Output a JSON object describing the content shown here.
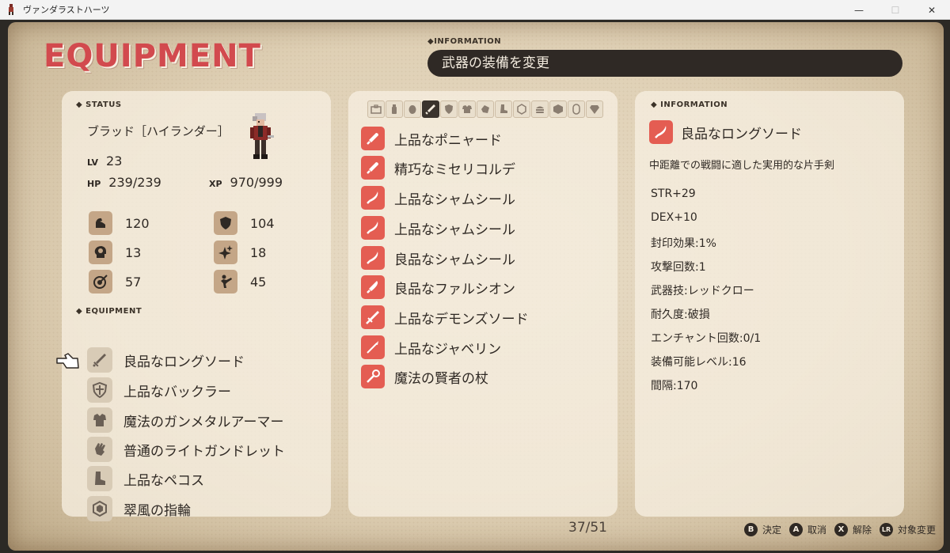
{
  "window": {
    "title": "ヴァンダラストハーツ",
    "controls": {
      "minimize": "—",
      "maximize": "☐",
      "close": "✕"
    }
  },
  "header": {
    "title": "EQUIPMENT",
    "info_label": "◆INFORMATION",
    "info_text": "武器の装備を変更"
  },
  "status": {
    "section_label": "◆ STATUS",
    "name": "ブラッド［ハイランダー］",
    "lv_label": "LV",
    "lv": "23",
    "hp_label": "HP",
    "hp": "239/239",
    "xp_label": "XP",
    "xp": "970/999",
    "attributes": [
      {
        "icon": "strength-arm-icon",
        "value": "120"
      },
      {
        "icon": "shield-defense-icon",
        "value": "104"
      },
      {
        "icon": "brain-intelligence-icon",
        "value": "13"
      },
      {
        "icon": "sparkle-magic-icon",
        "value": "18"
      },
      {
        "icon": "target-accuracy-icon",
        "value": "57"
      },
      {
        "icon": "kick-agility-icon",
        "value": "45"
      }
    ]
  },
  "equipment": {
    "section_label": "◆ EQUIPMENT",
    "items": [
      {
        "icon": "sword-icon",
        "name": "良品なロングソード"
      },
      {
        "icon": "shield-icon",
        "name": "上品なバックラー"
      },
      {
        "icon": "armor-icon",
        "name": "魔法のガンメタルアーマー"
      },
      {
        "icon": "gauntlet-icon",
        "name": "普通のライトガンドレット"
      },
      {
        "icon": "boots-icon",
        "name": "上品なペコス"
      },
      {
        "icon": "ring-icon",
        "name": "翠風の指輪"
      }
    ]
  },
  "categories": [
    "all-items-icon",
    "potion-icon",
    "egg-icon",
    "weapon-sword-icon",
    "shield-icon",
    "armor-icon",
    "gauntlet-icon",
    "boots-icon",
    "ring-icon",
    "food-icon",
    "cube-icon",
    "capsule-icon",
    "gem-icon"
  ],
  "weapons": [
    {
      "icon": "dagger-icon",
      "name": "上品なポニャード"
    },
    {
      "icon": "dagger-icon",
      "name": "精巧なミセリコルデ"
    },
    {
      "icon": "scimitar-icon",
      "name": "上品なシャムシール"
    },
    {
      "icon": "scimitar-icon",
      "name": "上品なシャムシール"
    },
    {
      "icon": "scimitar-icon",
      "name": "良品なシャムシール"
    },
    {
      "icon": "falchion-icon",
      "name": "良品なファルシオン"
    },
    {
      "icon": "longsword-icon",
      "name": "上品なデモンズソード"
    },
    {
      "icon": "javelin-icon",
      "name": "上品なジャベリン"
    },
    {
      "icon": "staff-icon",
      "name": "魔法の賢者の杖"
    }
  ],
  "detail": {
    "section_label": "◆ INFORMATION",
    "name": "良品なロングソード",
    "description": "中距離での戦闘に適した実用的な片手剣",
    "stats": [
      "STR+29",
      "DEX+10",
      "封印効果:1%",
      "攻撃回数:1",
      "武器技:レッドクロー",
      "耐久度:破損",
      "エンチャント回数:0/1",
      "装備可能レベル:16",
      "間隔:170"
    ]
  },
  "footer": {
    "page": "37/51",
    "controls": [
      {
        "button": "B",
        "label": "決定"
      },
      {
        "button": "A",
        "label": "取消"
      },
      {
        "button": "X",
        "label": "解除"
      },
      {
        "button": "LR",
        "label": "対象変更"
      }
    ]
  },
  "colors": {
    "accent_red": "#d24a4e",
    "weapon_icon_bg": "#e45d52",
    "dark": "#2f2925",
    "paper": "#e9ddc8"
  }
}
